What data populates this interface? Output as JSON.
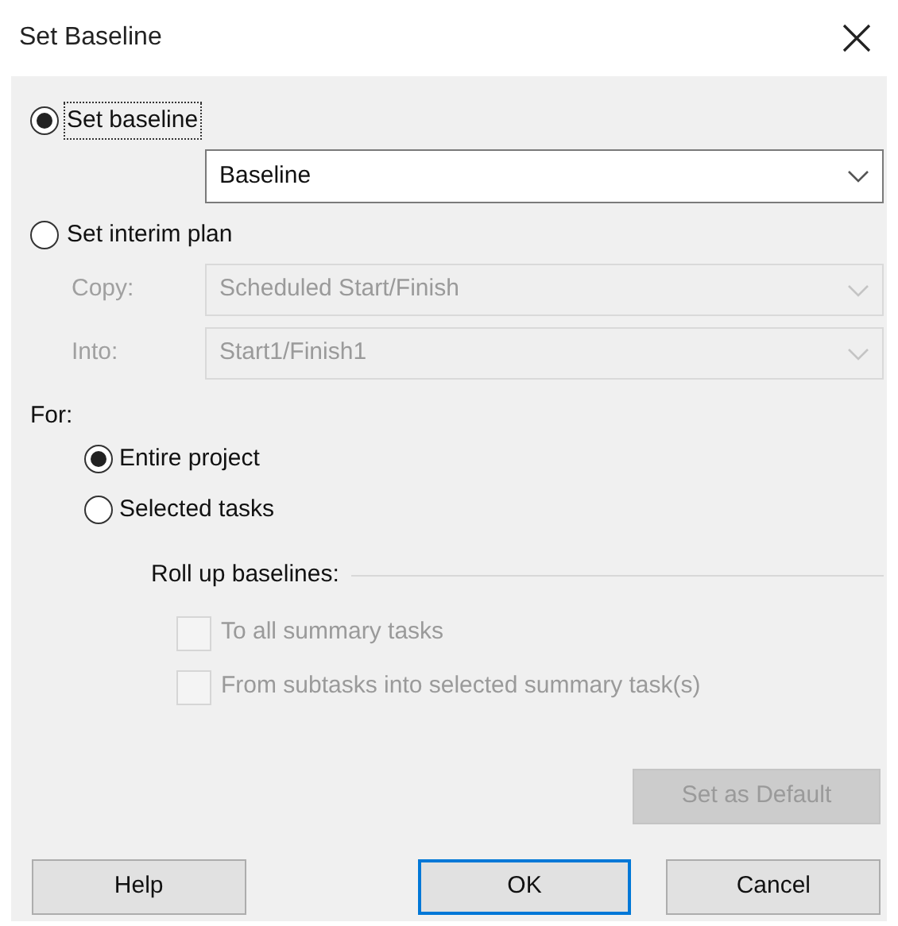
{
  "window": {
    "title": "Set Baseline"
  },
  "mode_options": [
    {
      "label": "Set baseline",
      "selected": true,
      "focused": true
    },
    {
      "label": "Set interim plan",
      "selected": false,
      "focused": false
    }
  ],
  "baseline_field": {
    "value": "Baseline",
    "disabled": false
  },
  "interim_fields": [
    {
      "label": "Copy:",
      "value": "Scheduled Start/Finish",
      "disabled": true
    },
    {
      "label": "Into:",
      "value": "Start1/Finish1",
      "disabled": true
    }
  ],
  "for": {
    "label": "For:",
    "options": [
      {
        "label": "Entire project",
        "selected": true
      },
      {
        "label": "Selected tasks",
        "selected": false
      }
    ]
  },
  "roll_up": {
    "label": "Roll up baselines:",
    "options": [
      {
        "label": "To all summary tasks",
        "checked": false,
        "disabled": true
      },
      {
        "label": "From subtasks into selected summary task(s)",
        "checked": false,
        "disabled": true
      }
    ]
  },
  "set_default_button": {
    "label": "Set as Default",
    "disabled": true
  },
  "buttons": [
    {
      "label": "Help",
      "default": false
    },
    {
      "label": "OK",
      "default": true
    },
    {
      "label": "Cancel",
      "default": false
    }
  ]
}
